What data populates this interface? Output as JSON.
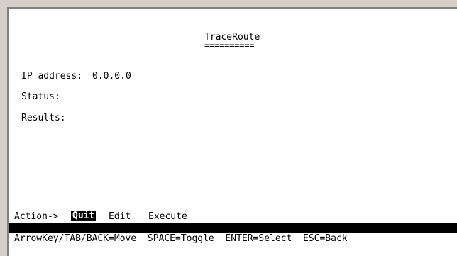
{
  "screen": {
    "title": "TraceRoute",
    "title_underline": "=========="
  },
  "fields": {
    "ip_label": "IP address:",
    "ip_value": "0.0.0.0",
    "status_label": "Status:",
    "status_value": "",
    "results_label": "Results:",
    "results_value": ""
  },
  "action_bar": {
    "label": "Action->",
    "items": [
      {
        "label": "Quit",
        "selected": true
      },
      {
        "label": "Edit",
        "selected": false
      },
      {
        "label": "Execute",
        "selected": false
      }
    ]
  },
  "help_bar": {
    "text": "ArrowKey/TAB/BACK=Move  SPACE=Toggle  ENTER=Select  ESC=Back"
  },
  "colors": {
    "background": "#ffffff",
    "text": "#000000",
    "highlight_bg": "#000000",
    "highlight_fg": "#ffffff",
    "window_chrome": "#d4d0c8"
  }
}
